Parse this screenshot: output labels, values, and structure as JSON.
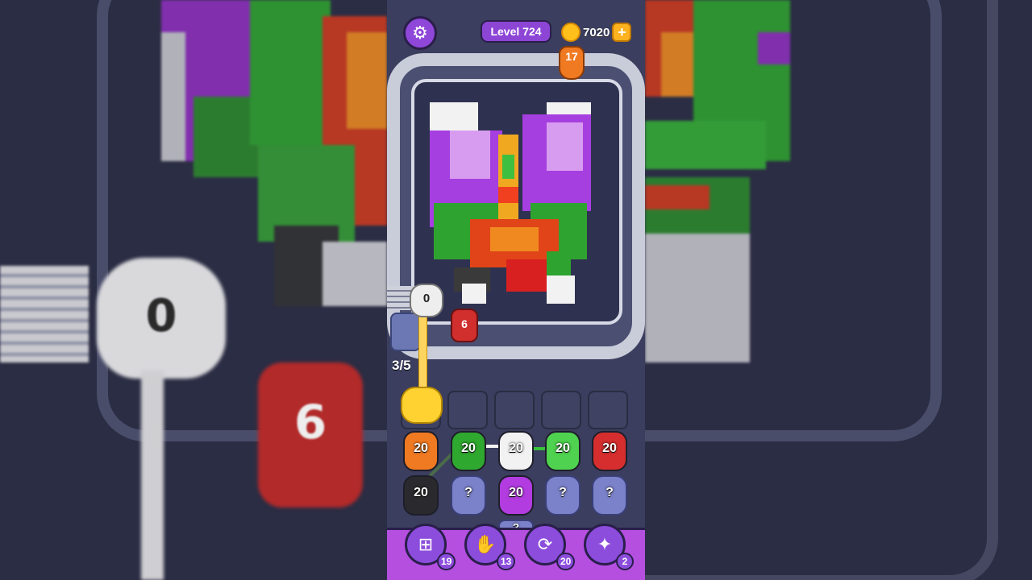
{
  "header": {
    "level_label": "Level 724",
    "coins": "7020",
    "coin_plus": "+"
  },
  "track": {
    "orange_blob_value": "17",
    "white_fist_value": "0",
    "red_blob_value": "6"
  },
  "queue_counter": "3/5",
  "grid": {
    "row1": [
      {
        "value": "20",
        "color": "#f07a22"
      },
      {
        "value": "20",
        "color": "#2fa82f"
      },
      {
        "value": "20",
        "color": "#f2f2f2"
      },
      {
        "value": "20",
        "color": "#4fd24f"
      },
      {
        "value": "20",
        "color": "#d62e2e"
      }
    ],
    "row2": [
      {
        "value": "20",
        "color": "#2a2a2e"
      },
      {
        "value": "?",
        "color": "#7b82c9"
      },
      {
        "value": "20",
        "color": "#b23ce0"
      },
      {
        "value": "?",
        "color": "#7b82c9"
      },
      {
        "value": "?",
        "color": "#7b82c9"
      }
    ],
    "row3_peek": [
      "?"
    ]
  },
  "boosters": [
    {
      "icon": "add-slot-icon",
      "count": "19"
    },
    {
      "icon": "hand-icon",
      "count": "13"
    },
    {
      "icon": "shuffle-icon",
      "count": "20"
    },
    {
      "icon": "magic-icon",
      "count": "2"
    }
  ],
  "backdrop": {
    "fist_value": "0",
    "red_value": "6"
  }
}
